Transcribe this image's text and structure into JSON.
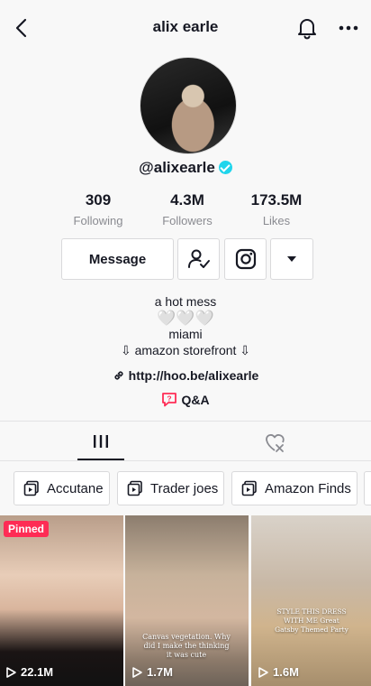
{
  "header": {
    "title": "alix earle"
  },
  "profile": {
    "handle": "@alixearle",
    "stats": [
      {
        "value": "309",
        "label": "Following"
      },
      {
        "value": "4.3M",
        "label": "Followers"
      },
      {
        "value": "173.5M",
        "label": "Likes"
      }
    ],
    "message_label": "Message",
    "bio_line1": "a hot mess",
    "bio_hearts": "🤍🤍🤍",
    "bio_line2": "miami",
    "bio_line3": "⇩ amazon storefront ⇩",
    "link": "http://hoo.be/alixearle",
    "qa_label": "Q&A"
  },
  "playlists": [
    "Accutane",
    "Trader joes",
    "Amazon Finds"
  ],
  "videos": [
    {
      "badge": "Pinned",
      "views": "22.1M",
      "caption": ""
    },
    {
      "badge": "",
      "views": "1.7M",
      "caption": "Canvas vegetation. Why did I make the thinking it was cute"
    },
    {
      "badge": "",
      "views": "1.6M",
      "caption": "STYLE THIS DRESS WITH ME Great Gatsby Themed Party"
    }
  ],
  "colors": {
    "accent": "#fe2c55",
    "verified": "#20d5ec",
    "text": "#161823",
    "muted": "#8a8b91"
  }
}
